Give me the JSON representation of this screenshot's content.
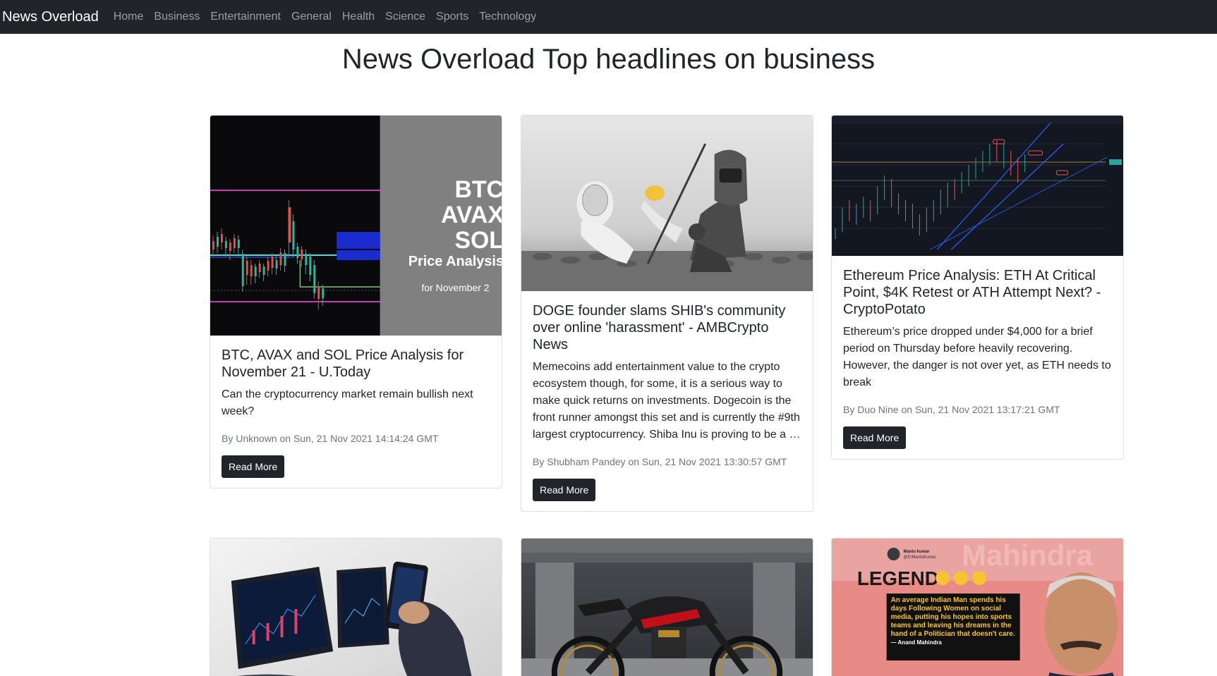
{
  "brand": "News Overload",
  "nav": [
    "Home",
    "Business",
    "Entertainment",
    "General",
    "Health",
    "Science",
    "Sports",
    "Technology"
  ],
  "page_title": "News Overload Top headlines on business",
  "read_more": "Read More",
  "articles": [
    {
      "title": "BTC, AVAX and SOL Price Analysis for November 21 - U.Today",
      "description": "Can the cryptocurrency market remain bullish next week?",
      "meta": "By Unknown on Sun, 21 Nov 2021 14:14:24 GMT",
      "image_text": {
        "line1": "BTC",
        "line2": "AVAX",
        "line3": "SOL",
        "line4": "Price Analysis",
        "line5": "for November 2"
      }
    },
    {
      "title": "DOGE founder slams SHIB's community over online 'harassment' - AMBCrypto News",
      "description": "Memecoins add entertainment value to the crypto ecosystem though, for some, it is a serious way to make quick returns on investments. Dogecoin is the front runner amongst this set and is currently the #9th largest cryptocurrency. Shiba Inu is proving to be a …",
      "meta": "By Shubham Pandey on Sun, 21 Nov 2021 13:30:57 GMT"
    },
    {
      "title": "Ethereum Price Analysis: ETH At Critical Point, $4K Retest or ATH Attempt Next? - CryptoPotato",
      "description": "Ethereum’s price dropped under $4,000 for a brief period on Thursday before heavily recovering. However, the danger is not over yet, as ETH needs to break",
      "meta": "By Duo Nine on Sun, 21 Nov 2021 13:17:21 GMT"
    },
    {
      "title": "",
      "description": "",
      "meta": ""
    },
    {
      "title": "",
      "description": "",
      "meta": ""
    },
    {
      "title": "",
      "description": "",
      "meta": "",
      "image_text": {
        "handle_name": "Mantu kumar",
        "handle": "@ErMantuKumar",
        "headline": "LEGEND",
        "quote": "An average Indian Man spends his days Following Women on social media, putting his hopes into sports teams and leaving his dreams in the hand of a Politician that doesn't care.",
        "attribution": "— Anand Mahindra",
        "bg_word": "Mahindra"
      }
    }
  ]
}
